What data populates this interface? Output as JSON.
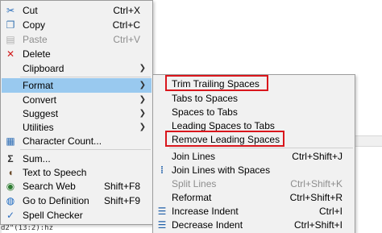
{
  "main_menu": {
    "cut": {
      "label": "Cut",
      "shortcut": "Ctrl+X"
    },
    "copy": {
      "label": "Copy",
      "shortcut": "Ctrl+C"
    },
    "paste": {
      "label": "Paste",
      "shortcut": "Ctrl+V"
    },
    "delete": {
      "label": "Delete"
    },
    "clipboard": {
      "label": "Clipboard"
    },
    "format": {
      "label": "Format"
    },
    "convert": {
      "label": "Convert"
    },
    "suggest": {
      "label": "Suggest"
    },
    "utilities": {
      "label": "Utilities"
    },
    "character_count": {
      "label": "Character Count..."
    },
    "sum": {
      "label": "Sum..."
    },
    "text_to_speech": {
      "label": "Text to Speech"
    },
    "search_web": {
      "label": "Search Web",
      "shortcut": "Shift+F8"
    },
    "go_to_definition": {
      "label": "Go to Definition",
      "shortcut": "Shift+F9"
    },
    "spell_checker": {
      "label": "Spell Checker"
    }
  },
  "format_submenu": {
    "trim_trailing_spaces": {
      "label": "Trim Trailing Spaces"
    },
    "tabs_to_spaces": {
      "label": "Tabs to Spaces"
    },
    "spaces_to_tabs": {
      "label": "Spaces to Tabs"
    },
    "leading_spaces_to_tabs": {
      "label": "Leading Spaces to Tabs"
    },
    "remove_leading_spaces": {
      "label": "Remove Leading Spaces"
    },
    "join_lines": {
      "label": "Join Lines",
      "shortcut": "Ctrl+Shift+J"
    },
    "join_lines_with_spaces": {
      "label": "Join Lines with Spaces"
    },
    "split_lines": {
      "label": "Split Lines",
      "shortcut": "Ctrl+Shift+K"
    },
    "reformat": {
      "label": "Reformat",
      "shortcut": "Ctrl+Shift+R"
    },
    "increase_indent": {
      "label": "Increase Indent",
      "shortcut": "Ctrl+I"
    },
    "decrease_indent": {
      "label": "Decrease Indent",
      "shortcut": "Ctrl+Shift+I"
    }
  },
  "status_bar": {
    "text": "d2\"(13:2):hz"
  },
  "colors": {
    "highlight": "#99c9ef",
    "annotation_red": "#d9161c",
    "menu_bg": "#f1f1f1"
  }
}
